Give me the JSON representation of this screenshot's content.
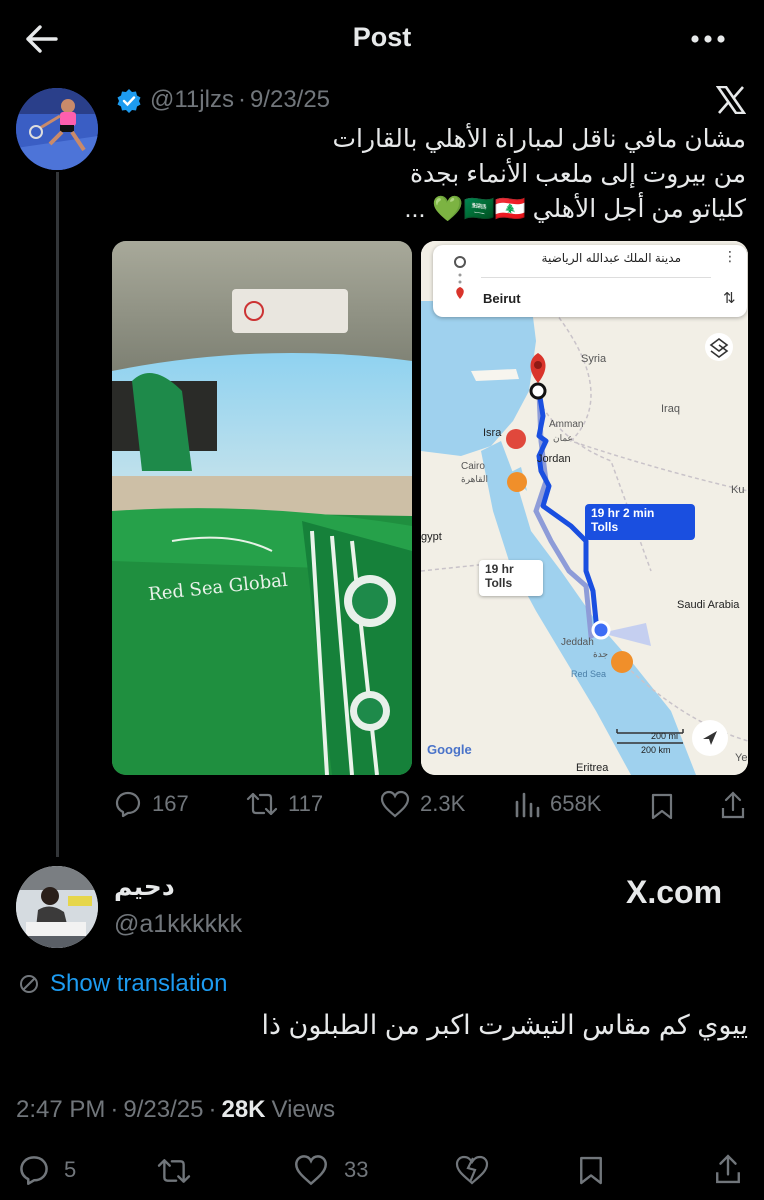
{
  "header": {
    "title": "Post"
  },
  "post": {
    "handle": "@11jlzs",
    "dot": "·",
    "date": "9/23/25",
    "text_lines": [
      "مشان مافي ناقل لمباراة الأهلي بالقارات",
      "من بيروت إلى ملعب الأنماء بجدة",
      "كلياتو من أجل الأهلي 🇸🇦🇱🇧💚 ..."
    ],
    "stats": {
      "replies": "167",
      "reposts": "117",
      "likes": "2.3K",
      "views": "658K"
    },
    "map": {
      "destination": "مدينة الملك عبدالله الرياضية",
      "origin": "Beirut",
      "route_main": {
        "time": "19 hr 2 min",
        "tolls": "Tolls"
      },
      "route_alt": {
        "time": "19 hr",
        "tolls": "Tolls"
      },
      "labels": {
        "syria": "Syria",
        "iraq": "Iraq",
        "amman": "Amman",
        "amman_ar": "عمان",
        "israel": "Isra",
        "jordan": "Jordan",
        "cairo": "Cairo",
        "cairo_ar": "القاهرة",
        "egypt": "gypt",
        "saudi": "Saudi Arabia",
        "jeddah": "Jeddah",
        "jeddah_ar": "جدة",
        "redsea": "Red Sea",
        "eritrea": "Eritrea",
        "ku": "Ku",
        "ye": "Ye",
        "google": "Google",
        "scale_mi": "200 mi",
        "scale_km": "200 km"
      }
    },
    "photo": {
      "sponsor": "Red Sea Global"
    }
  },
  "reply": {
    "name": "دحيم",
    "handle": "@a1kkkkkk",
    "watermark": "X.com",
    "show_translation": "Show translation",
    "text": "ييوي كم مقاس التيشرت اكبر من الطبلون ذا",
    "time": "2:47 PM",
    "dot": "·",
    "date": "9/23/25",
    "views_count": "28K",
    "views_label": "Views",
    "stats": {
      "replies": "5",
      "likes": "33"
    }
  }
}
